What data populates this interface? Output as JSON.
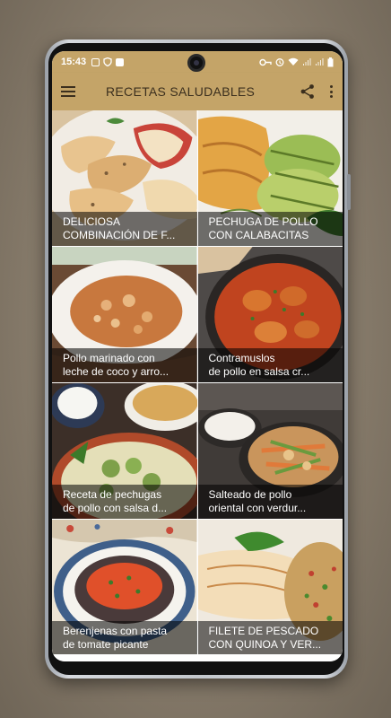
{
  "status_bar": {
    "time": "15:43",
    "icons_left": [
      "image-icon",
      "shield-icon",
      "check-icon"
    ],
    "icons_right": [
      "key-icon",
      "alarm-icon",
      "wifi-icon",
      "signal-icon",
      "signal-icon",
      "battery-icon"
    ]
  },
  "app_bar": {
    "title": "RECETAS SALUDABLES",
    "icons": [
      "menu-icon",
      "share-icon",
      "more-vert-icon"
    ]
  },
  "colors": {
    "accent": "#c4a468",
    "title_text": "#3b2f1e",
    "caption_overlay": "rgba(0,0,0,0.55)"
  },
  "recipes": [
    {
      "line1": "DELICIOSA",
      "line2": "COMBINACIÓN DE F..."
    },
    {
      "line1": "PECHUGA DE POLLO",
      "line2": "CON CALABACITAS"
    },
    {
      "line1": "Pollo marinado con",
      "line2": "leche de coco y arro..."
    },
    {
      "line1": "Contramuslos",
      "line2": "de pollo en salsa cr..."
    },
    {
      "line1": "Receta de pechugas",
      "line2": "de pollo con salsa d..."
    },
    {
      "line1": "Salteado de pollo",
      "line2": "oriental con verdur..."
    },
    {
      "line1": "Berenjenas con pasta",
      "line2": "de tomate picante"
    },
    {
      "line1": "FILETE DE PESCADO",
      "line2": "CON QUINOA Y VER..."
    }
  ]
}
